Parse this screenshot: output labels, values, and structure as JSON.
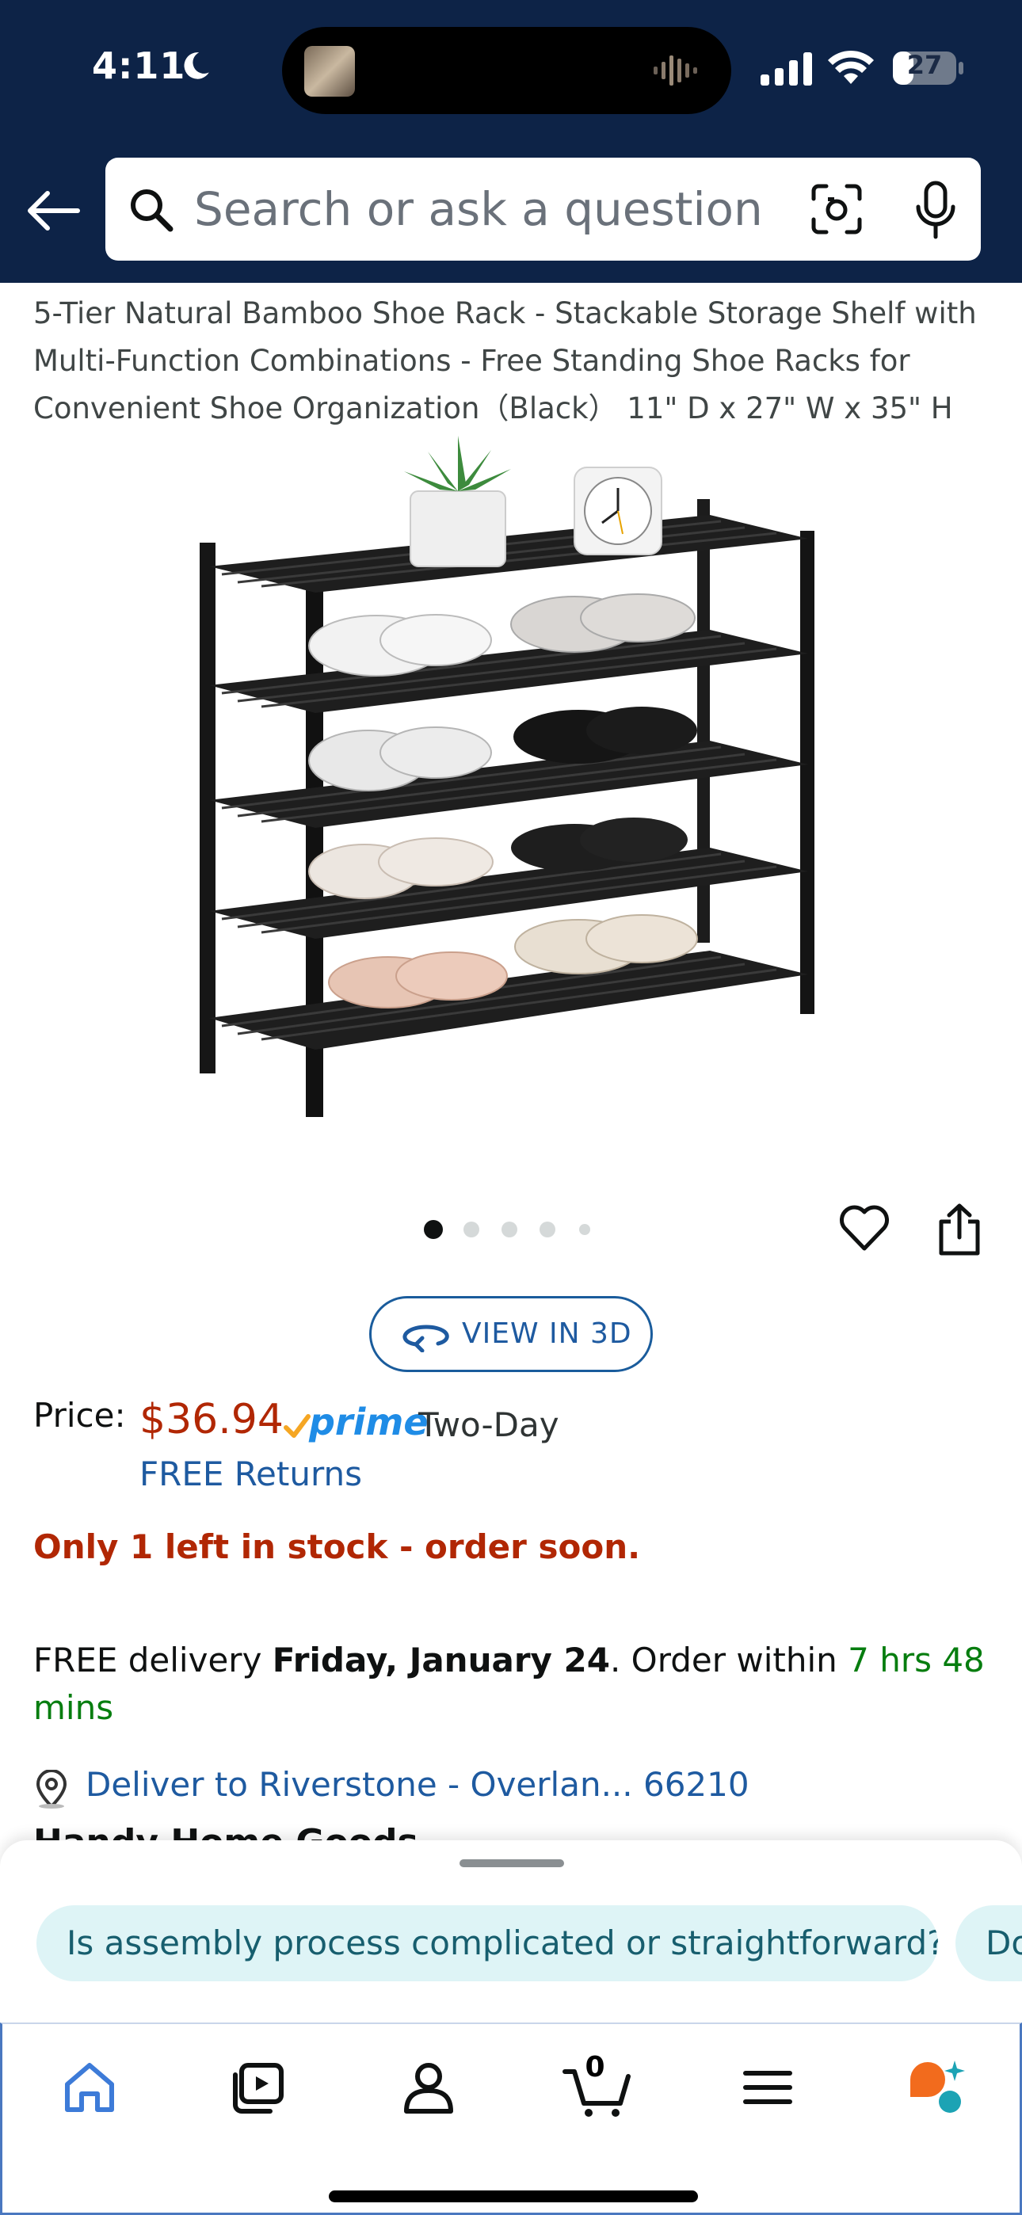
{
  "status_bar": {
    "time": "4:11",
    "battery": "27"
  },
  "search": {
    "placeholder": "Search or ask a question"
  },
  "product": {
    "title": "5-Tier Natural Bamboo Shoe Rack - Stackable Storage Shelf with Multi-Function Combinations - Free Standing Shoe Racks for Convenient Shoe Organization（Black） 11\" D x 27\" W x 35\" H",
    "image_count": 5,
    "active_image": 1
  },
  "view_in_3d": {
    "label": "VIEW IN 3D"
  },
  "price": {
    "label": "Price:",
    "value": "$36.94",
    "prime_word": "prime",
    "prime_delivery": "Two-Day",
    "returns": "FREE Returns"
  },
  "stock": {
    "message": "Only 1 left in stock - order soon."
  },
  "delivery": {
    "prefix": "FREE delivery ",
    "date": "Friday, January 24",
    "middle": ". Order within ",
    "countdown": "7 hrs 48 mins"
  },
  "location": {
    "deliver_to": "Deliver to Riverstone - Overlan... 66210"
  },
  "next_section": {
    "heading": "Handy Home Goods"
  },
  "suggestions": [
    "Is assembly process complicated or straightforward?",
    "Do"
  ],
  "bottom_nav": {
    "items": [
      "home",
      "video",
      "account",
      "cart",
      "menu",
      "rufus"
    ],
    "cart_count": "0"
  },
  "colors": {
    "header_bg": "#0d2347",
    "price": "#b12704",
    "link": "#1e5aa0",
    "prime": "#1f8ce6",
    "countdown": "#067d0f",
    "chip_bg": "#def4f6"
  }
}
